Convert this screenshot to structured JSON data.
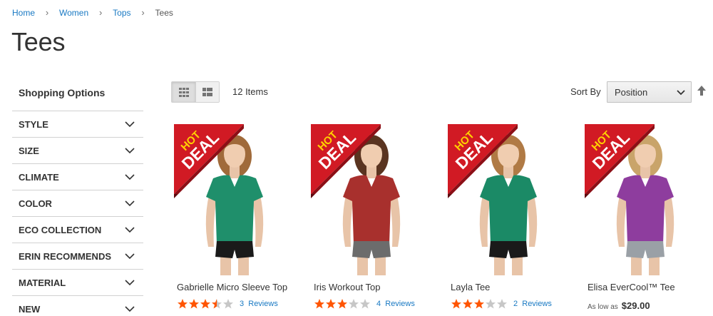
{
  "breadcrumb": {
    "items": [
      "Home",
      "Women",
      "Tops"
    ],
    "current": "Tees",
    "separator": "›"
  },
  "page": {
    "title": "Tees"
  },
  "sidebar": {
    "title": "Shopping Options",
    "filters": [
      "STYLE",
      "SIZE",
      "CLIMATE",
      "COLOR",
      "ECO COLLECTION",
      "ERIN RECOMMENDS",
      "MATERIAL",
      "NEW"
    ]
  },
  "toolbar": {
    "view_modes": [
      {
        "name": "grid",
        "icon": "grid-icon",
        "active": true
      },
      {
        "name": "list",
        "icon": "list-icon",
        "active": false
      }
    ],
    "items_count": "12 Items",
    "sort_label": "Sort By",
    "sort_selected": "Position",
    "sort_direction_icon": "arrow-up-icon"
  },
  "badge": {
    "line1": "HOT",
    "line2": "DEAL"
  },
  "products": [
    {
      "name": "Gabrielle Micro Sleeve Top",
      "rating": 3.5,
      "reviews_count": "3",
      "reviews_label": "Reviews",
      "shirt_color": "#1f8f6b",
      "shorts_color": "#1a1a1a",
      "hair_color": "#a06a3a"
    },
    {
      "name": "Iris Workout Top",
      "rating": 3,
      "reviews_count": "4",
      "reviews_label": "Reviews",
      "shirt_color": "#a8302d",
      "shorts_color": "#6c6c6c",
      "hair_color": "#5a3420"
    },
    {
      "name": "Layla Tee",
      "rating": 3,
      "reviews_count": "2",
      "reviews_label": "Reviews",
      "shirt_color": "#1b8a66",
      "shorts_color": "#1a1a1a",
      "hair_color": "#b07a45"
    },
    {
      "name": "Elisa EverCool™ Tee",
      "price_label": "As low as",
      "price": "$29.00",
      "shirt_color": "#8e3d9e",
      "shorts_color": "#9aa0a6",
      "hair_color": "#c9a46a"
    }
  ],
  "colors": {
    "link": "#1979c3",
    "star_filled": "#ff5501",
    "star_empty": "#c7c7c7",
    "badge_red": "#d11a24"
  }
}
